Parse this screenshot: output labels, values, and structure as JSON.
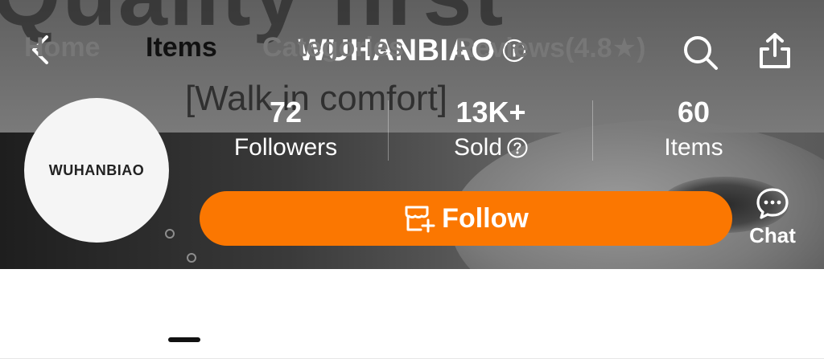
{
  "header": {
    "store_name": "WUHANBIAO",
    "banner_text": "Quality first",
    "banner_tagline": "[Walk in comfort]"
  },
  "avatar": {
    "text": "WUHANBIAO"
  },
  "stats": [
    {
      "value": "72",
      "label": "Followers"
    },
    {
      "value": "13K+",
      "label": "Sold"
    },
    {
      "value": "60",
      "label": "Items"
    }
  ],
  "follow_button": {
    "label": "Follow",
    "color": "#fb7701"
  },
  "chat": {
    "label": "Chat"
  },
  "tabs": [
    {
      "label": "Home",
      "active": false
    },
    {
      "label": "Items",
      "active": true
    },
    {
      "label": "Categories",
      "active": false
    },
    {
      "label": "Reviews(4.8★)",
      "active": false
    }
  ],
  "icons": {
    "back": "chevron-left-icon",
    "info": "info-icon",
    "search": "search-icon",
    "share": "share-icon",
    "help": "question-icon",
    "follow": "store-add-icon",
    "chat": "chat-bubble-icon"
  }
}
